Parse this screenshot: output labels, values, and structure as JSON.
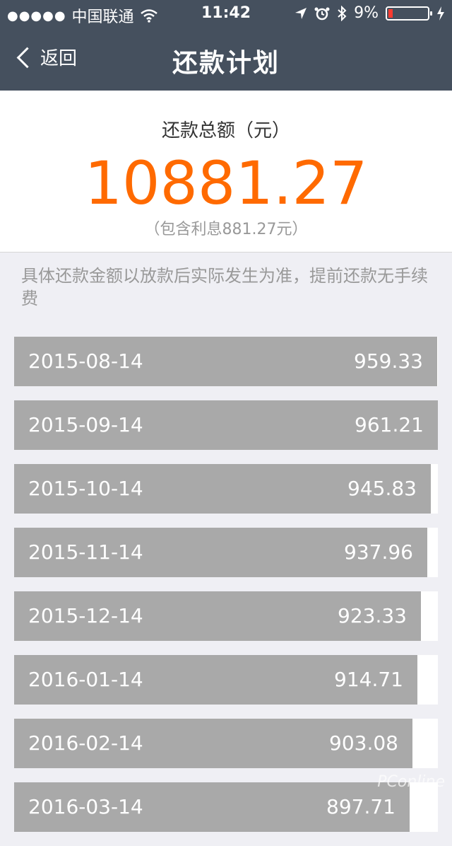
{
  "status_bar": {
    "signal_dots": "●●●●●",
    "carrier": "中国联通",
    "time": "11:42",
    "battery_percent": "9%"
  },
  "nav": {
    "back_label": "返回",
    "title": "还款计划"
  },
  "summary": {
    "label": "还款总额（元）",
    "total": "10881.27",
    "interest_note": "（包含利息881.27元）"
  },
  "note": "具体还款金额以放款后实际发生为准，提前还款无手续费",
  "schedule": [
    {
      "date": "2015-08-14",
      "amount": "959.33"
    },
    {
      "date": "2015-09-14",
      "amount": "961.21"
    },
    {
      "date": "2015-10-14",
      "amount": "945.83"
    },
    {
      "date": "2015-11-14",
      "amount": "937.96"
    },
    {
      "date": "2015-12-14",
      "amount": "923.33"
    },
    {
      "date": "2016-01-14",
      "amount": "914.71"
    },
    {
      "date": "2016-02-14",
      "amount": "903.08"
    },
    {
      "date": "2016-03-14",
      "amount": "897.71"
    }
  ],
  "watermark": "PConline",
  "colors": {
    "nav_bg": "#45505e",
    "accent_orange": "#ff6a00",
    "bar_gray": "#a9a9a9",
    "battery_red": "#ff3b30"
  }
}
